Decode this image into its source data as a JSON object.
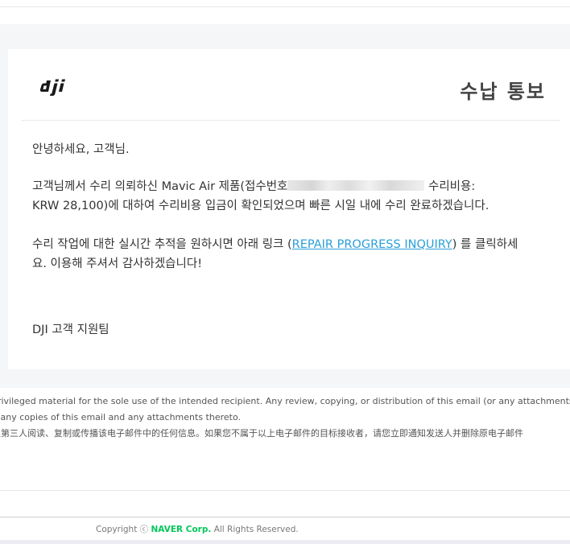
{
  "email": {
    "title": "수납 통보",
    "greeting": "안녕하세요, 고객님.",
    "para1_part1": "고객님께서 수리 의뢰하신 Mavic Air 제품(접수번호",
    "para1_part2": " 수리비용:",
    "para1_line2": "KRW 28,100)에 대하여 수리비용 입금이 확인되었으며 빠른 시일 내에 수리 완료하겠습니다.",
    "para2_part1": "수리 작업에 대한 실시간 추적을 원하시면 아래 링크 (",
    "link_text": "REPAIR PROGRESS INQUIRY",
    "para2_part2": ") 를 클릭하세",
    "para2_line2": "요. 이용해 주셔서 감사하겠습니다!",
    "signature": "DJI 고객 지원팀"
  },
  "disclaimer": {
    "line1": "privileged material for the sole use of the intended recipient. Any review, copying, or distribution of this email (or any attachments",
    "line2": "d any copies of this email and any attachments thereto.",
    "line3": "让第三人阅读、复制或传播该电子邮件中的任何信息。如果您不属于以上电子邮件的目标接收者，请您立即通知发送人并删除原电子邮件"
  },
  "footer": {
    "copyright_prefix": "Copyright ⓒ",
    "brand": "NAVER Corp.",
    "copyright_suffix": "All Rights Reserved."
  },
  "colors": {
    "link": "#2a9fd8",
    "brand": "#03c75a",
    "background": "#f5f6f8"
  },
  "icons": {
    "logo": "dji-logo"
  }
}
